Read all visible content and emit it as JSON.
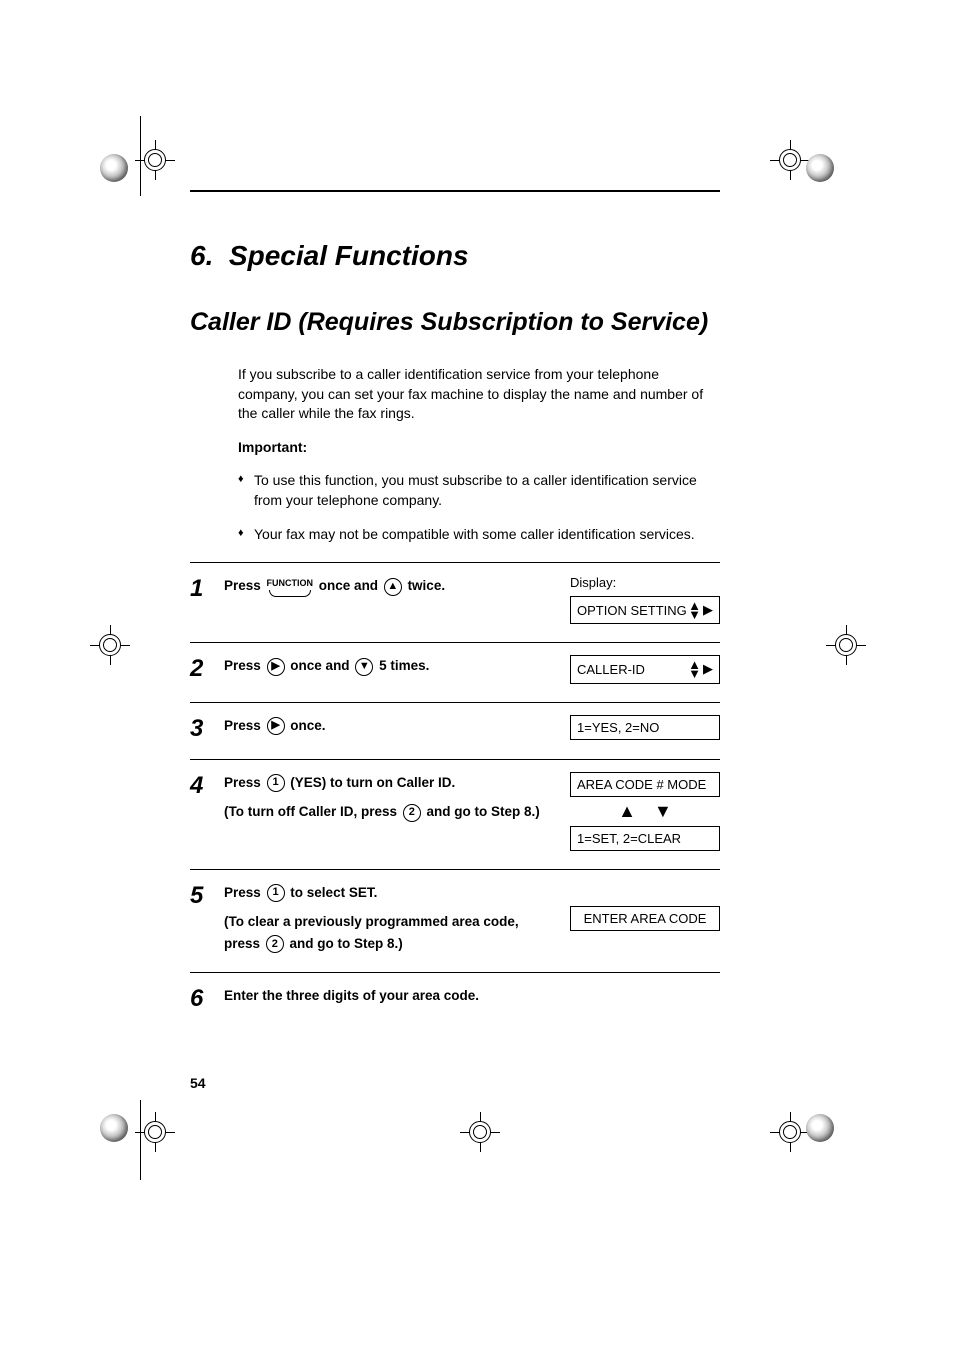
{
  "chapter": {
    "number": "6.",
    "title": "Special Functions"
  },
  "section": {
    "title": "Caller ID (Requires Subscription to Service)"
  },
  "intro": {
    "paragraph": "If you subscribe to a caller identification service from your telephone company, you can set your fax machine to display the name and number of the caller while the fax rings.",
    "important_label": "Important:",
    "bullets": [
      "To use this function, you must subscribe to a caller identification service from your telephone company.",
      "Your fax may not be compatible with some caller identification services."
    ]
  },
  "buttons": {
    "function": "FUNCTION",
    "up": "▲",
    "down": "▼",
    "right": "▶",
    "one": "1",
    "two": "2"
  },
  "steps": [
    {
      "num": "1",
      "parts": [
        "Press ",
        {
          "btn": "function"
        },
        " once and ",
        {
          "btn": "up"
        },
        " twice."
      ],
      "display_label": "Display:",
      "display_lines": [
        {
          "text": "OPTION SETTING",
          "icons": "updown-right"
        }
      ]
    },
    {
      "num": "2",
      "parts": [
        "Press ",
        {
          "btn": "right"
        },
        " once and ",
        {
          "btn": "down"
        },
        " 5 times."
      ],
      "display_lines": [
        {
          "text": "CALLER-ID",
          "icons": "updown-leftright"
        }
      ]
    },
    {
      "num": "3",
      "parts": [
        "Press ",
        {
          "btn": "right"
        },
        " once."
      ],
      "display_lines": [
        {
          "text": "1=YES, 2=NO"
        }
      ]
    },
    {
      "num": "4",
      "parts": [
        "Press ",
        {
          "btn": "one"
        },
        " (YES) to turn on Caller ID."
      ],
      "sub_parts": [
        "(To turn off Caller ID, press ",
        {
          "btn": "two"
        },
        " and go to Step 8.)"
      ],
      "display_lines": [
        {
          "text": "AREA CODE # MODE"
        },
        {
          "arrows": true
        },
        {
          "text": "1=SET, 2=CLEAR"
        }
      ]
    },
    {
      "num": "5",
      "parts": [
        "Press ",
        {
          "btn": "one"
        },
        " to select SET."
      ],
      "sub_parts": [
        "(To clear a previously programmed area code, press ",
        {
          "btn": "two"
        },
        " and go to Step 8.)"
      ],
      "display_lines": [
        {
          "text": "ENTER AREA CODE",
          "center": true
        }
      ],
      "display_offset": true
    },
    {
      "num": "6",
      "parts": [
        "Enter the three digits of your area code."
      ]
    }
  ],
  "page_number": "54"
}
